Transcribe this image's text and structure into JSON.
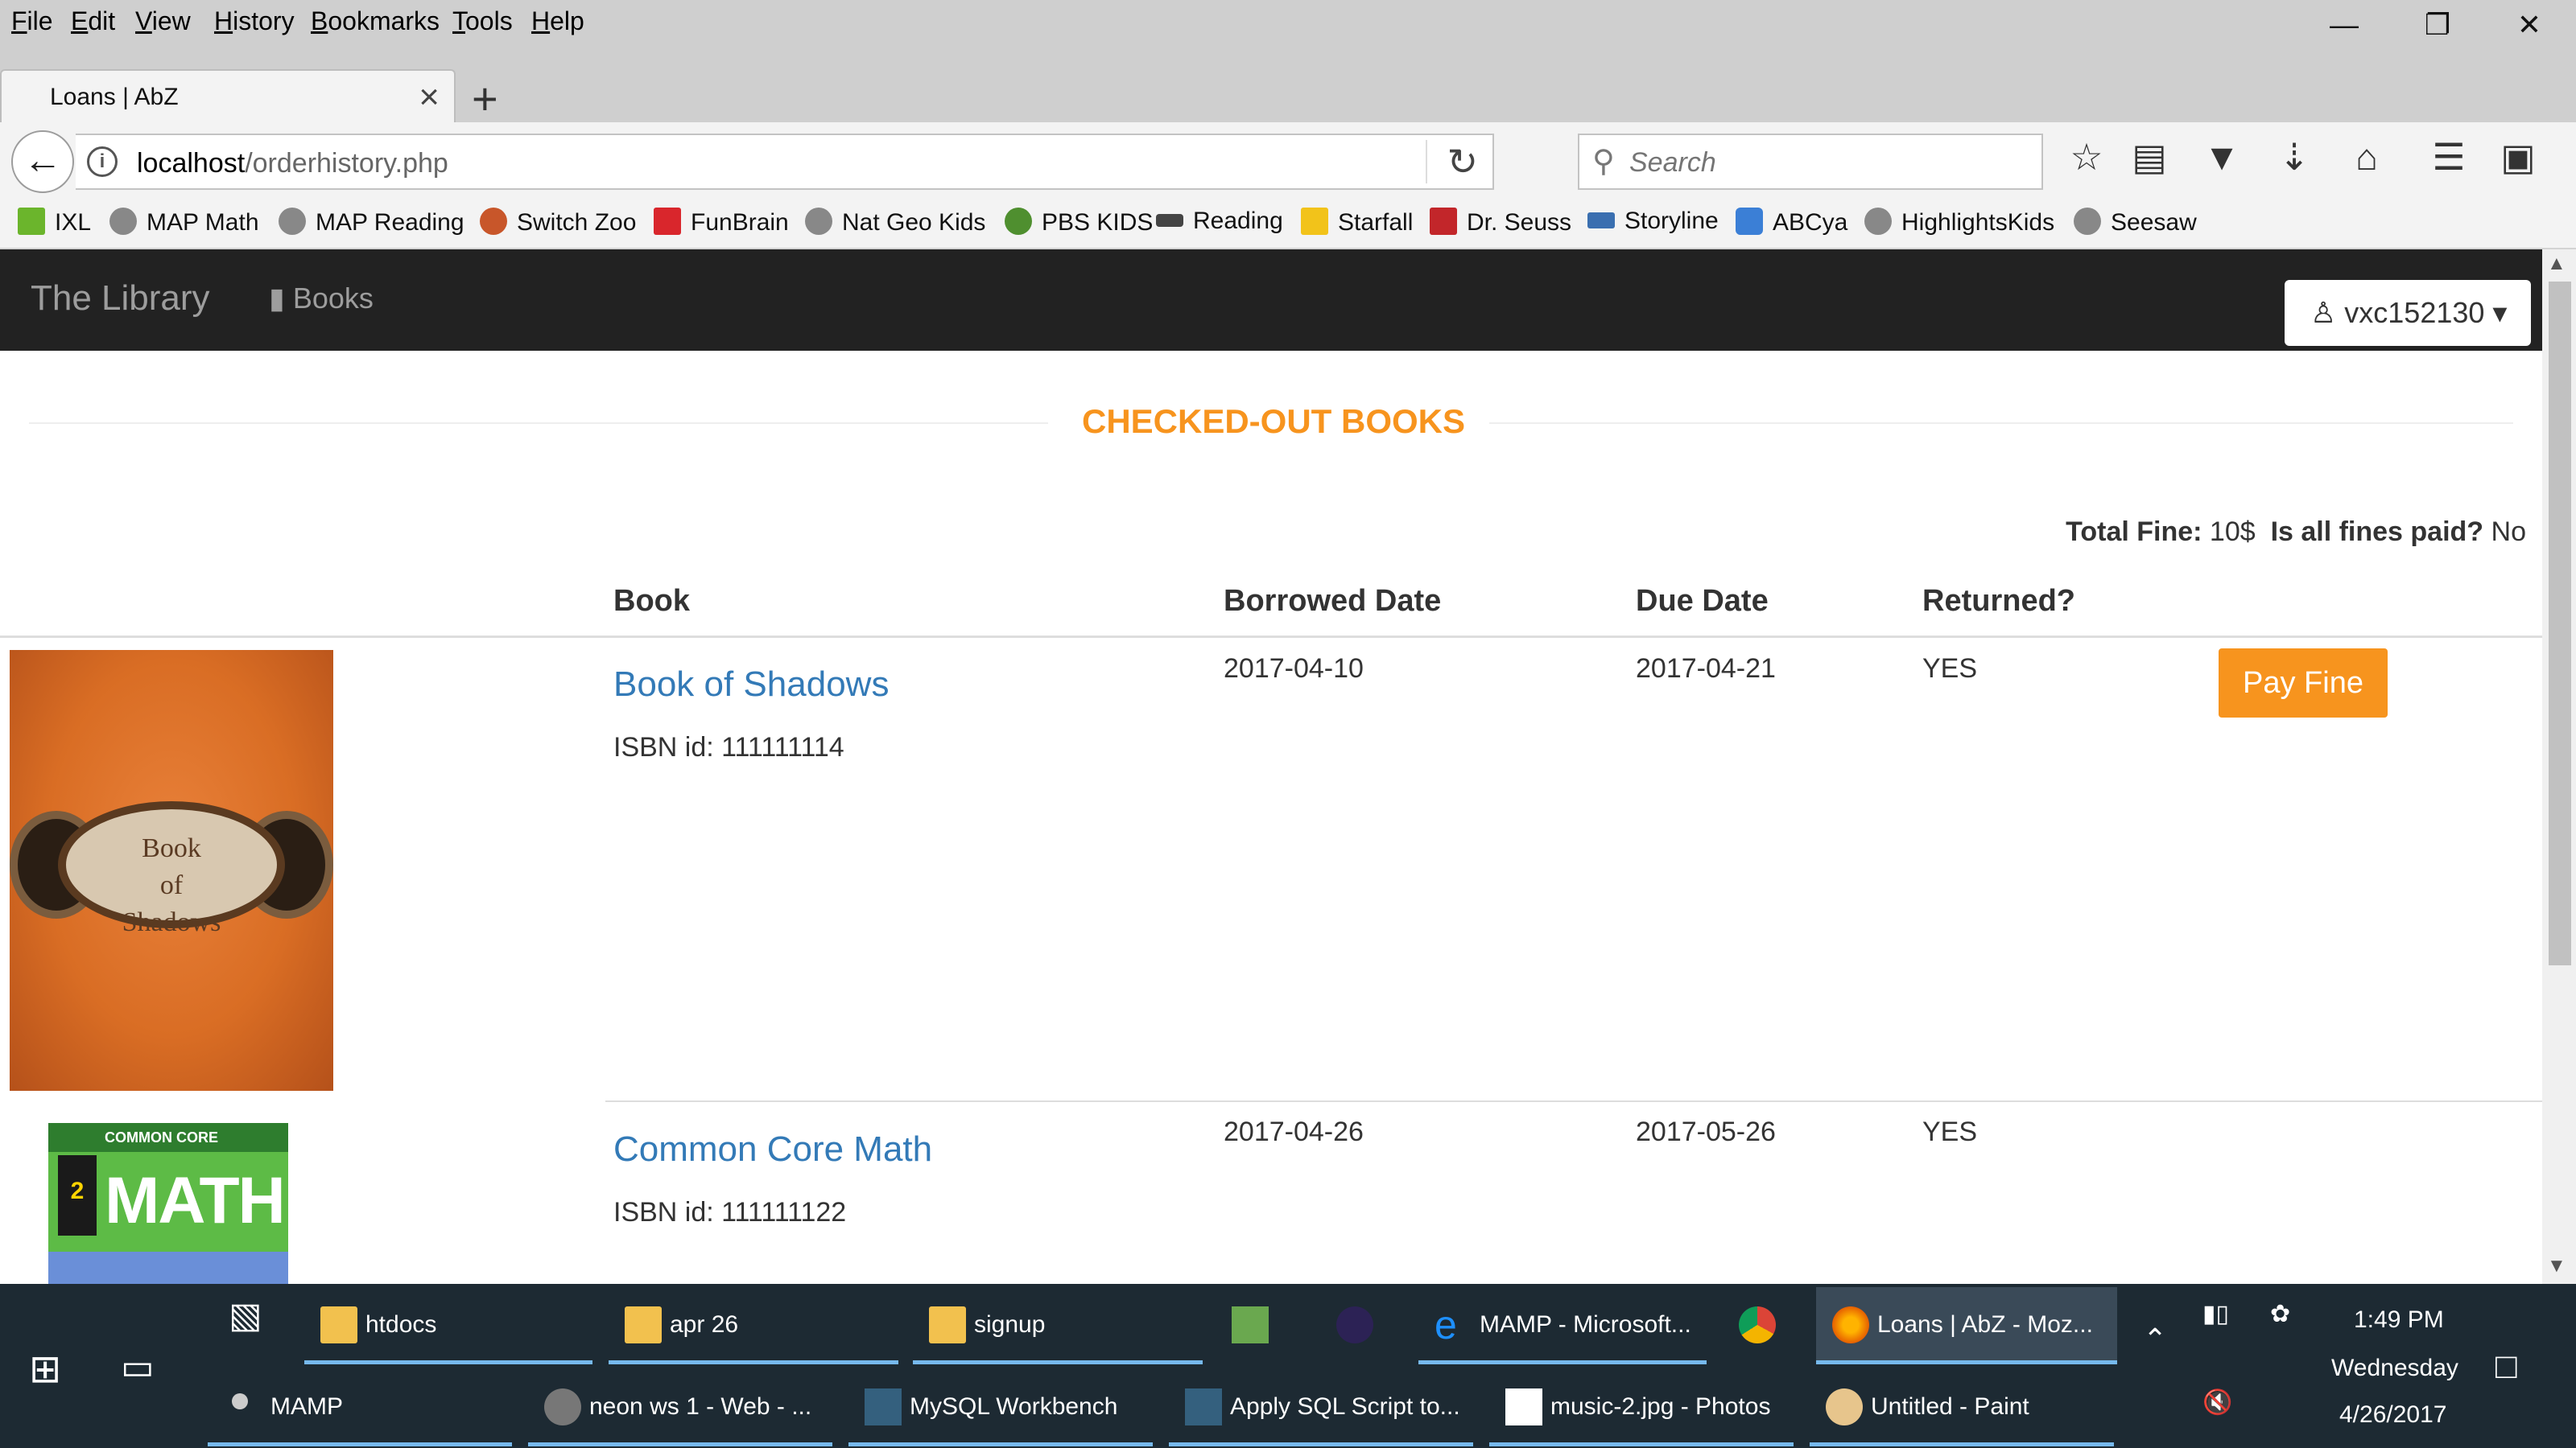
{
  "browser": {
    "menu": [
      "File",
      "Edit",
      "View",
      "History",
      "Bookmarks",
      "Tools",
      "Help"
    ],
    "tab_title": "Loans | AbZ",
    "url_host": "localhost",
    "url_path": "/orderhistory.php",
    "search_placeholder": "Search",
    "bookmarks": [
      "IXL",
      "MAP Math",
      "MAP Reading",
      "Switch Zoo",
      "FunBrain",
      "Nat Geo Kids",
      "PBS KIDS",
      "Reading",
      "Starfall",
      "Dr. Seuss",
      "Storyline",
      "ABCya",
      "HighlightsKids",
      "Seesaw"
    ],
    "icons": [
      "back-arrow-icon",
      "info-icon",
      "reload-icon",
      "search-icon",
      "star-icon",
      "reading-list-icon",
      "pocket-icon",
      "download-icon",
      "home-icon",
      "hamburger-menu-icon",
      "extension-icon"
    ]
  },
  "site": {
    "brand": "The Library",
    "nav_books": "Books",
    "user": "vxc152130",
    "section_title": "CHECKED-OUT BOOKS",
    "fine": {
      "total_label": "Total Fine:",
      "total_value": "10$",
      "paid_label": "Is all fines paid?",
      "paid_value": "No"
    },
    "columns": [
      "Book",
      "Borrowed Date",
      "Due Date",
      "Returned?"
    ],
    "loans": [
      {
        "title": "Book of Shadows",
        "isbn": "ISBN id: 111111114",
        "borrowed": "2017-04-10",
        "due": "2017-04-21",
        "returned": "YES",
        "action": "Pay Fine",
        "cover_text": "Book of Shadows"
      },
      {
        "title": "Common Core Math",
        "isbn": "ISBN id: 111111122",
        "borrowed": "2017-04-26",
        "due": "2017-05-26",
        "returned": "YES",
        "cover_text": "MATH",
        "cover_grade": "2",
        "cover_band": "COMMON CORE"
      }
    ],
    "accent_color": "#f7941e",
    "link_color": "#337ab7"
  },
  "taskbar": {
    "row1": [
      "htdocs",
      "apr 26",
      "signup",
      "MAMP - Microsoft...",
      "Loans | AbZ - Moz..."
    ],
    "row2": [
      "MAMP",
      "neon ws 1 - Web - ...",
      "MySQL Workbench",
      "Apply SQL Script to...",
      "music-2.jpg - Photos",
      "Untitled - Paint"
    ],
    "clock_time": "1:49 PM",
    "clock_day": "Wednesday",
    "clock_date": "4/26/2017"
  }
}
